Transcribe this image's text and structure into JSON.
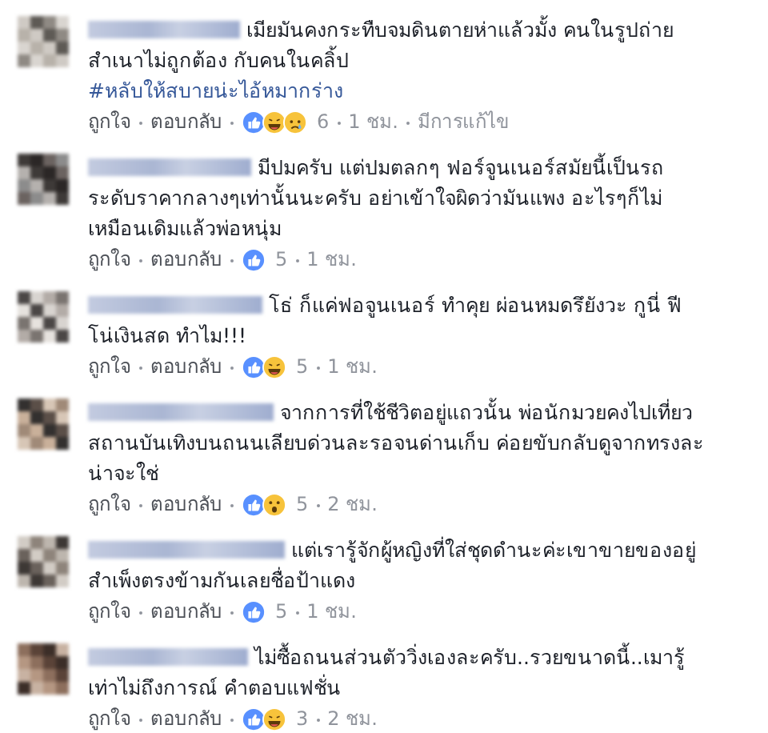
{
  "comments": [
    {
      "text": "เมียมันคงกระทืบจมดินตายห่าแล้วมั้ง คนในรูปถ่ายสำเนาไม่ถูกต้อง กับคนในคลิ้ป",
      "hashtag": "#หลับให้สบายน่ะไอ้หมากร่าง",
      "like": "ถูกใจ",
      "reply": "ตอบกลับ",
      "reactions": [
        {
          "kind": "like"
        },
        {
          "kind": "haha"
        },
        {
          "kind": "sad"
        }
      ],
      "count": "6",
      "time": "1 ชม.",
      "edited": "มีการแก้ไข"
    },
    {
      "text": "มีปมครับ แต่ปมตลกๆ ฟอร์จูนเนอร์สมัยนี้เป็นรถระดับราคากลางๆเท่านั้นนะครับ อย่าเข้าใจผิดว่ามันแพง อะไรๆก็ไม่เหมือนเดิมแล้วพ่อหนุ่ม",
      "like": "ถูกใจ",
      "reply": "ตอบกลับ",
      "reactions": [
        {
          "kind": "like"
        }
      ],
      "count": "5",
      "time": "1 ชม."
    },
    {
      "text": "โธ่ ก็แค่ฟอจูนเนอร์ ทำคุย ผ่อนหมดรึยังวะ กูนี่ ฟีโน่เงินสด ทำไม!!!",
      "like": "ถูกใจ",
      "reply": "ตอบกลับ",
      "reactions": [
        {
          "kind": "like"
        },
        {
          "kind": "haha"
        }
      ],
      "count": "5",
      "time": "1 ชม."
    },
    {
      "text": "จากการที่ใช้ชีวิตอยู่แถวนั้น พ่อนักมวยคงไปเที่ยวสถานบันเทิงบนถนนเลียบด่วนละรอจนด่านเก็บ ค่อยขับกลับดูจากทรงละน่าจะใช่",
      "like": "ถูกใจ",
      "reply": "ตอบกลับ",
      "reactions": [
        {
          "kind": "like"
        },
        {
          "kind": "wow"
        }
      ],
      "count": "5",
      "time": "2 ชม."
    },
    {
      "text": "แต่เรารู้จักผู้หญิงที่ใส่ชุดดำนะค่ะเขาขายของอยู่สำเพ็งตรงข้ามกันเลยชื่อป้าแดง",
      "like": "ถูกใจ",
      "reply": "ตอบกลับ",
      "reactions": [
        {
          "kind": "like"
        }
      ],
      "count": "5",
      "time": "1 ชม."
    },
    {
      "text": "ไม่ซื้อถนนส่วนตัววิ่งเองละครับ..รวยขนาดนี้..เมารู้เท่าไม่ถึงการณ์ คำตอบแฟชั่น",
      "like": "ถูกใจ",
      "reply": "ตอบกลับ",
      "reactions": [
        {
          "kind": "like"
        },
        {
          "kind": "haha"
        }
      ],
      "count": "3",
      "time": "2 ชม."
    }
  ]
}
